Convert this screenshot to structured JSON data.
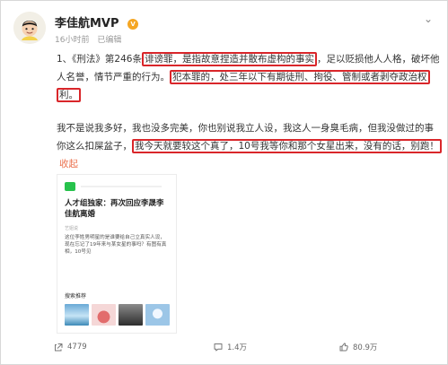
{
  "post": {
    "author": "李佳航MVP",
    "vip_badge": "V",
    "time": "16小时前",
    "source": "已编辑",
    "paragraphs": [
      [
        {
          "text": "1、《刑法》第246条",
          "highlight": false
        },
        {
          "text": "诽谤罪，是指故意捏造并散布虚构的事实",
          "highlight": true
        },
        {
          "text": "，足以贬损他人人格，破坏他人名誉，情节严重的行为。",
          "highlight": false
        },
        {
          "text": "犯本罪的，处三年以下有期徒刑、拘役、管制或者剥夺政治权利。",
          "highlight": true
        }
      ],
      [
        {
          "text": "我不是说我多好，我也没多完美，你也别说我立人设，我这人一身臭毛病，但我没做过的事你这么扣屎盆子，",
          "highlight": false
        },
        {
          "text": "我今天就要较这个真了，10号我等你和那个女星出来，没有的话，别跑！",
          "highlight": true
        }
      ]
    ],
    "collapse_label": "收起"
  },
  "card": {
    "title": "人才组独家：再次回应李晟李佳航离婚",
    "source": "艺姐说",
    "body": "这位李姓男明星的是谁要给自己立真实人设，现在忘记了19年来与某女星的事吗？有图有真相，10号见",
    "section_label": "搜索推荐"
  },
  "footer": {
    "share_count": "4779",
    "comment_count": "1.4万",
    "like_count": "80.9万"
  },
  "colors": {
    "highlight_border": "#d9262a",
    "link": "#eb7350",
    "text": "#333333",
    "muted": "#999999"
  },
  "icons": {
    "avatar": "cartoon-avatar",
    "more": "chevron-down-icon",
    "share": "share-icon",
    "comment": "comment-icon",
    "like": "like-icon",
    "card_logo": "green-app-logo"
  }
}
